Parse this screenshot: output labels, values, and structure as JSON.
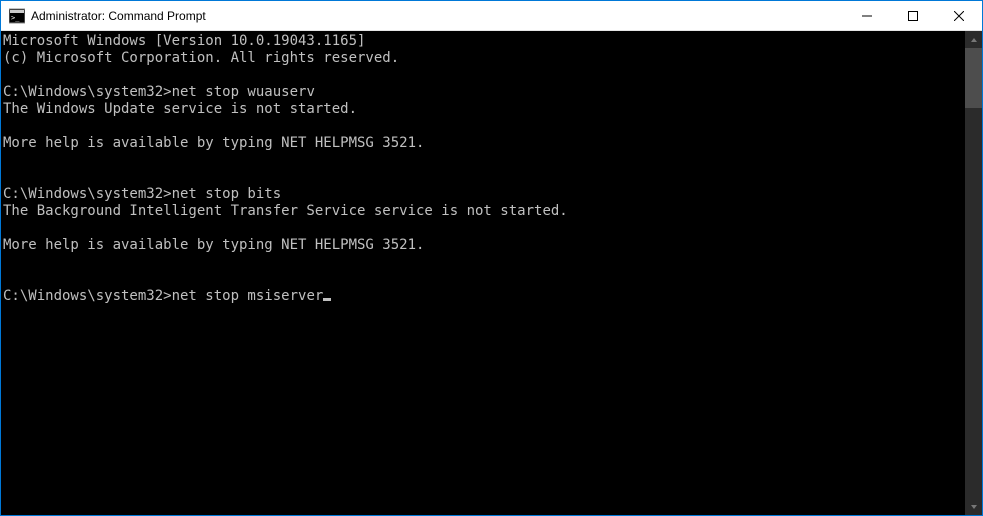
{
  "window": {
    "title": "Administrator: Command Prompt"
  },
  "console": {
    "header1": "Microsoft Windows [Version 10.0.19043.1165]",
    "header2": "(c) Microsoft Corporation. All rights reserved.",
    "blank": "",
    "prompt": "C:\\Windows\\system32>",
    "cmd1": "net stop wuauserv",
    "out1a": "The Windows Update service is not started.",
    "out1b": "More help is available by typing NET HELPMSG 3521.",
    "cmd2": "net stop bits",
    "out2a": "The Background Intelligent Transfer Service service is not started.",
    "out2b": "More help is available by typing NET HELPMSG 3521.",
    "cmd3": "net stop msiserver"
  }
}
